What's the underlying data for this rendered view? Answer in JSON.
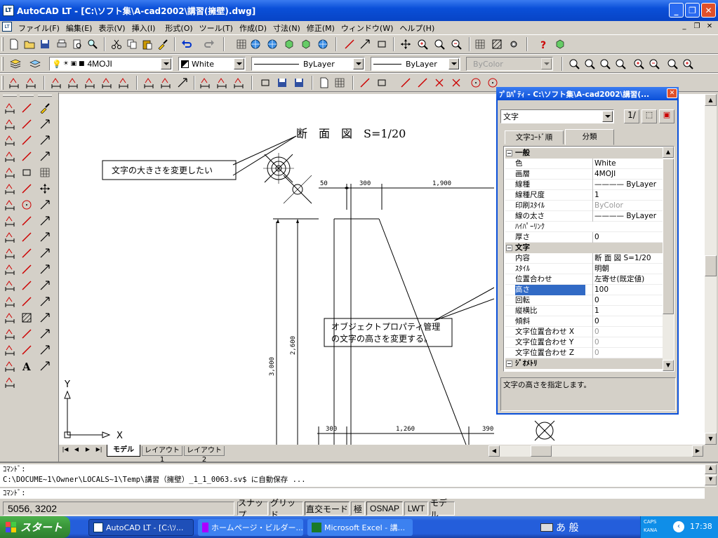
{
  "window": {
    "title": "AutoCAD LT - [C:\\ソフト集\\A-cad2002\\講習(擁壁).dwg]"
  },
  "menu": {
    "items": [
      "ファイル(F)",
      "編集(E)",
      "表示(V)",
      "挿入(I)",
      "形式(O)",
      "ツール(T)",
      "作成(D)",
      "寸法(N)",
      "修正(M)",
      "ウィンドウ(W)",
      "ヘルプ(H)"
    ]
  },
  "layer_combo": {
    "value": "4MOJI"
  },
  "color_combo": {
    "value": "White"
  },
  "linetype_combo": {
    "value": "ByLayer"
  },
  "lineweight_combo": {
    "value": "ByLayer"
  },
  "plotstyle_combo": {
    "value": "ByColor"
  },
  "drawing": {
    "title_text": "断　面　図　S=1/20",
    "callout1": "文字の大きさを変更したい",
    "callout2_line1": "オブジェクトプロパティ管理",
    "callout2_line2": "の文字の高さを変更する。",
    "dim_50": "50",
    "dim_300_top": "300",
    "dim_1900": "1,900",
    "dim_2600": "2,600",
    "dim_3000": "3,000",
    "dim_300_bot": "300",
    "dim_1260": "1,260",
    "dim_390": "390",
    "ucs_y": "Y",
    "ucs_x": "X"
  },
  "layout_tabs": [
    "モデル",
    "レイアウト1",
    "レイアウト2"
  ],
  "properties": {
    "title": "ﾌﾟﾛﾊﾟﾃｨ - C:\\ソフト集\\A-cad2002\\講習(...",
    "object_type": "文字",
    "tabs": [
      "文字ｺｰﾄﾞ順",
      "分類"
    ],
    "rows": [
      {
        "k": "一般",
        "v": "",
        "cat": true
      },
      {
        "k": "色",
        "v": "White"
      },
      {
        "k": "画層",
        "v": "4MOJI"
      },
      {
        "k": "線種",
        "v": "———— ByLayer"
      },
      {
        "k": "線種尺度",
        "v": "1"
      },
      {
        "k": "印刷ｽﾀｲﾙ",
        "v": "ByColor",
        "gray": true
      },
      {
        "k": "線の太さ",
        "v": "———— ByLayer"
      },
      {
        "k": "ﾊｲﾊﾟｰﾘﾝｸ",
        "v": ""
      },
      {
        "k": "厚さ",
        "v": "0"
      },
      {
        "k": "文字",
        "v": "",
        "cat": true
      },
      {
        "k": "内容",
        "v": "断 面 図 S=1/20"
      },
      {
        "k": "ｽﾀｲﾙ",
        "v": "明朝"
      },
      {
        "k": "位置合わせ",
        "v": "左寄せ(既定値)"
      },
      {
        "k": "高さ",
        "v": "100",
        "sel": true
      },
      {
        "k": "回転",
        "v": "0"
      },
      {
        "k": "縦横比",
        "v": "1"
      },
      {
        "k": "傾斜",
        "v": "0"
      },
      {
        "k": "文字位置合わせ X",
        "v": "0",
        "gray": true
      },
      {
        "k": "文字位置合わせ Y",
        "v": "0",
        "gray": true
      },
      {
        "k": "文字位置合わせ Z",
        "v": "0",
        "gray": true
      },
      {
        "k": "ｼﾞｵﾒﾄﾘ",
        "v": "",
        "cat": true
      }
    ],
    "description": "文字の高さを指定します。"
  },
  "command": {
    "line1": "ｺﾏﾝﾄﾞ:",
    "line2": "C:\\DOCUME~1\\Owner\\LOCALS~1\\Temp\\講習（擁壁）_1_1_0063.sv$ に自動保存 ...",
    "prompt": "ｺﾏﾝﾄﾞ:"
  },
  "status": {
    "coords": "5056, 3202",
    "snap": "スナップ",
    "grid": "グリッド",
    "ortho": "直交モード",
    "polar": "極",
    "osnap": "OSNAP",
    "lwt": "LWT",
    "model": "モデル"
  },
  "taskbar": {
    "start": "スタート",
    "tasks": [
      "AutoCAD LT - [C:\\ｿ...",
      "ホームページ・ビルダー...",
      "Microsoft Excel - 講..."
    ],
    "ime": "あ 般",
    "caps": "CAPS",
    "kana": "KANA",
    "clock": "17:38"
  },
  "colors": {
    "titlebar": "#0a4fd8",
    "selection": "#316ac5",
    "taskbar": "#245edb",
    "start": "#3c9a3c"
  }
}
